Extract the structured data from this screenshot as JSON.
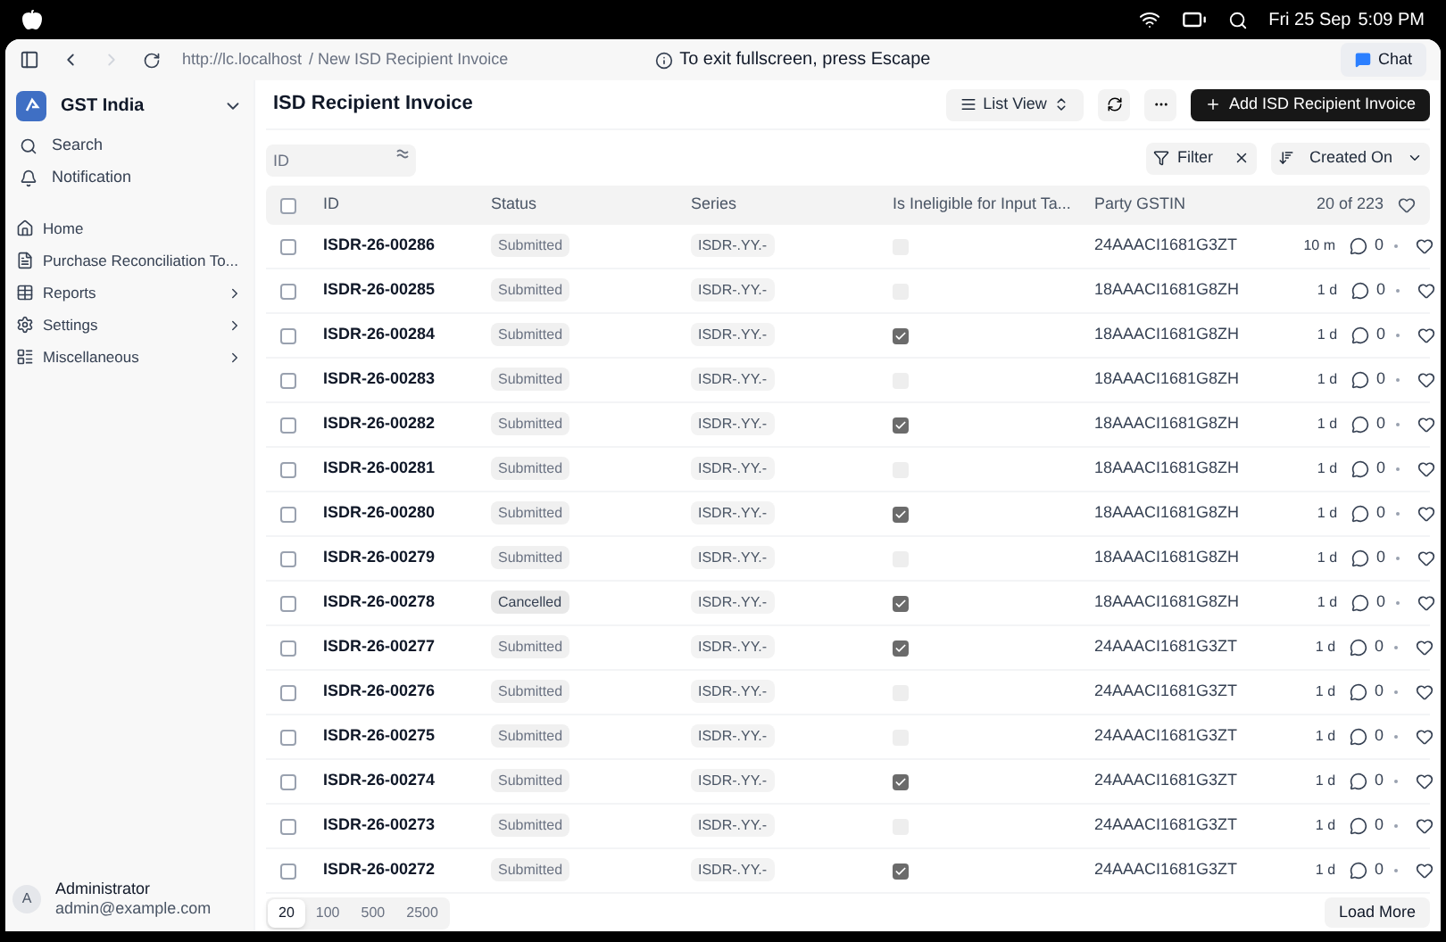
{
  "menu_bar": {
    "date": "Fri 25 Sep",
    "time": "5:09 PM"
  },
  "browser": {
    "url_host": "http://lc.localhost",
    "url_path": "/ New ISD Recipient Invoice",
    "notice": "To exit fullscreen, press Escape",
    "chat": "Chat"
  },
  "sidebar": {
    "workspace": "GST India",
    "top_items": [
      {
        "label": "Search"
      },
      {
        "label": "Notification"
      }
    ],
    "items": [
      {
        "label": "Home",
        "expandable": false
      },
      {
        "label": "Purchase Reconciliation To...",
        "expandable": false
      },
      {
        "label": "Reports",
        "expandable": true
      },
      {
        "label": "Settings",
        "expandable": true
      },
      {
        "label": "Miscellaneous",
        "expandable": true
      }
    ],
    "user": {
      "initial": "A",
      "name": "Administrator",
      "email": "admin@example.com"
    }
  },
  "page": {
    "title": "ISD Recipient Invoice",
    "view": "List View",
    "add_button": "Add ISD Recipient Invoice"
  },
  "filters": {
    "id_placeholder": "ID",
    "filter": "Filter",
    "sort": "Created On"
  },
  "table": {
    "all_checked": false,
    "columns": [
      "ID",
      "Status",
      "Series",
      "Is Ineligible for Input Ta...",
      "Party GSTIN"
    ],
    "count": "20 of 223",
    "rows": [
      {
        "checked": false,
        "id": "ISDR-26-00286",
        "status": "Submitted",
        "series": "ISDR-.YY.-",
        "ineligible": false,
        "gstin": "24AAACI1681G3ZT",
        "age": "10 m",
        "comments": "0"
      },
      {
        "checked": false,
        "id": "ISDR-26-00285",
        "status": "Submitted",
        "series": "ISDR-.YY.-",
        "ineligible": false,
        "gstin": "18AAACI1681G8ZH",
        "age": "1 d",
        "comments": "0"
      },
      {
        "checked": false,
        "id": "ISDR-26-00284",
        "status": "Submitted",
        "series": "ISDR-.YY.-",
        "ineligible": true,
        "gstin": "18AAACI1681G8ZH",
        "age": "1 d",
        "comments": "0"
      },
      {
        "checked": false,
        "id": "ISDR-26-00283",
        "status": "Submitted",
        "series": "ISDR-.YY.-",
        "ineligible": false,
        "gstin": "18AAACI1681G8ZH",
        "age": "1 d",
        "comments": "0"
      },
      {
        "checked": false,
        "id": "ISDR-26-00282",
        "status": "Submitted",
        "series": "ISDR-.YY.-",
        "ineligible": true,
        "gstin": "18AAACI1681G8ZH",
        "age": "1 d",
        "comments": "0"
      },
      {
        "checked": false,
        "id": "ISDR-26-00281",
        "status": "Submitted",
        "series": "ISDR-.YY.-",
        "ineligible": false,
        "gstin": "18AAACI1681G8ZH",
        "age": "1 d",
        "comments": "0"
      },
      {
        "checked": false,
        "id": "ISDR-26-00280",
        "status": "Submitted",
        "series": "ISDR-.YY.-",
        "ineligible": true,
        "gstin": "18AAACI1681G8ZH",
        "age": "1 d",
        "comments": "0"
      },
      {
        "checked": false,
        "id": "ISDR-26-00279",
        "status": "Submitted",
        "series": "ISDR-.YY.-",
        "ineligible": false,
        "gstin": "18AAACI1681G8ZH",
        "age": "1 d",
        "comments": "0"
      },
      {
        "checked": false,
        "id": "ISDR-26-00278",
        "status": "Cancelled",
        "series": "ISDR-.YY.-",
        "ineligible": true,
        "gstin": "18AAACI1681G8ZH",
        "age": "1 d",
        "comments": "0"
      },
      {
        "checked": false,
        "id": "ISDR-26-00277",
        "status": "Submitted",
        "series": "ISDR-.YY.-",
        "ineligible": true,
        "gstin": "24AAACI1681G3ZT",
        "age": "1 d",
        "comments": "0"
      },
      {
        "checked": false,
        "id": "ISDR-26-00276",
        "status": "Submitted",
        "series": "ISDR-.YY.-",
        "ineligible": false,
        "gstin": "24AAACI1681G3ZT",
        "age": "1 d",
        "comments": "0"
      },
      {
        "checked": false,
        "id": "ISDR-26-00275",
        "status": "Submitted",
        "series": "ISDR-.YY.-",
        "ineligible": false,
        "gstin": "24AAACI1681G3ZT",
        "age": "1 d",
        "comments": "0"
      },
      {
        "checked": false,
        "id": "ISDR-26-00274",
        "status": "Submitted",
        "series": "ISDR-.YY.-",
        "ineligible": true,
        "gstin": "24AAACI1681G3ZT",
        "age": "1 d",
        "comments": "0"
      },
      {
        "checked": false,
        "id": "ISDR-26-00273",
        "status": "Submitted",
        "series": "ISDR-.YY.-",
        "ineligible": false,
        "gstin": "24AAACI1681G3ZT",
        "age": "1 d",
        "comments": "0"
      },
      {
        "checked": false,
        "id": "ISDR-26-00272",
        "status": "Submitted",
        "series": "ISDR-.YY.-",
        "ineligible": true,
        "gstin": "24AAACI1681G3ZT",
        "age": "1 d",
        "comments": "0"
      }
    ]
  },
  "footer": {
    "page_sizes": [
      {
        "label": "20",
        "selected": true
      },
      {
        "label": "100",
        "selected": false
      },
      {
        "label": "500",
        "selected": false
      },
      {
        "label": "2500",
        "selected": false
      }
    ],
    "load_more": "Load More"
  }
}
